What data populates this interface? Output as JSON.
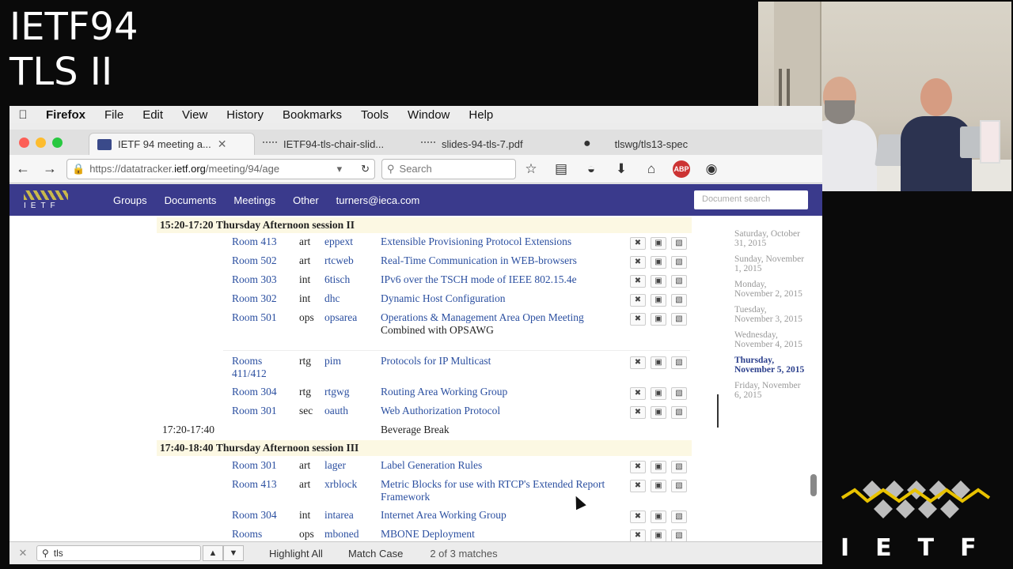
{
  "overlay": {
    "line1": "IETF94",
    "line2": "TLS II"
  },
  "logo": {
    "text": "IETF"
  },
  "menubar": {
    "app": "Firefox",
    "items": [
      "File",
      "Edit",
      "View",
      "History",
      "Bookmarks",
      "Tools",
      "Window",
      "Help"
    ]
  },
  "tabs": [
    {
      "label": "IETF 94 meeting a...",
      "active": true
    },
    {
      "label": "IETF94-tls-chair-slid...",
      "active": false
    },
    {
      "label": "slides-94-tls-7.pdf",
      "active": false
    },
    {
      "label": "tlswg/tls13-spec",
      "active": false
    }
  ],
  "urlbar": {
    "prefix": "https://datatracker.",
    "domain": "ietf.org",
    "suffix": "/meeting/94/age"
  },
  "search": {
    "placeholder": "Search"
  },
  "site": {
    "nav": [
      "Groups",
      "Documents",
      "Meetings",
      "Other",
      "turners@ieca.com"
    ],
    "docsearch_placeholder": "Document search"
  },
  "sessions": [
    {
      "time": "15:20-17:20",
      "name": "Thursday Afternoon session II"
    },
    {
      "time": "17:40-18:40",
      "name": "Thursday Afternoon session III"
    }
  ],
  "rows": [
    {
      "room": "Room 413",
      "area": "art",
      "acronym": "eppext",
      "title": "Extensible Provisioning Protocol Extensions"
    },
    {
      "room": "Room 502",
      "area": "art",
      "acronym": "rtcweb",
      "title": "Real-Time Communication in WEB-browsers"
    },
    {
      "room": "Room 303",
      "area": "int",
      "acronym": "6tisch",
      "title": "IPv6 over the TSCH mode of IEEE 802.15.4e"
    },
    {
      "room": "Room 302",
      "area": "int",
      "acronym": "dhc",
      "title": "Dynamic Host Configuration"
    },
    {
      "room": "Room 501",
      "area": "ops",
      "acronym": "opsarea",
      "title": "Operations & Management Area Open Meeting",
      "note": "Combined with OPSAWG"
    },
    {
      "room": "Rooms 411/412",
      "area": "rtg",
      "acronym": "pim",
      "title": "Protocols for IP Multicast"
    },
    {
      "room": "Room 304",
      "area": "rtg",
      "acronym": "rtgwg",
      "title": "Routing Area Working Group"
    },
    {
      "room": "Room 301",
      "area": "sec",
      "acronym": "oauth",
      "title": "Web Authorization Protocol"
    },
    {
      "room": "Room 301",
      "area": "art",
      "acronym": "lager",
      "title": "Label Generation Rules"
    },
    {
      "room": "Room 413",
      "area": "art",
      "acronym": "xrblock",
      "title": "Metric Blocks for use with RTCP's Extended Report Framework"
    },
    {
      "room": "Room 304",
      "area": "int",
      "acronym": "intarea",
      "title": "Internet Area Working Group"
    },
    {
      "room": "Rooms",
      "area": "ops",
      "acronym": "mboned",
      "title": "MBONE Deployment"
    }
  ],
  "break": {
    "time": "17:20-17:40",
    "label": "Beverage Break"
  },
  "days": [
    "Saturday, October 31, 2015",
    "Sunday, November 1, 2015",
    "Monday, November 2, 2015",
    "Tuesday, November 3, 2015",
    "Wednesday, November 4, 2015",
    "Thursday, November 5, 2015",
    "Friday, November 6, 2015"
  ],
  "findbar": {
    "query": "tls",
    "highlight": "Highlight All",
    "match_case": "Match Case",
    "status": "2 of 3 matches"
  }
}
